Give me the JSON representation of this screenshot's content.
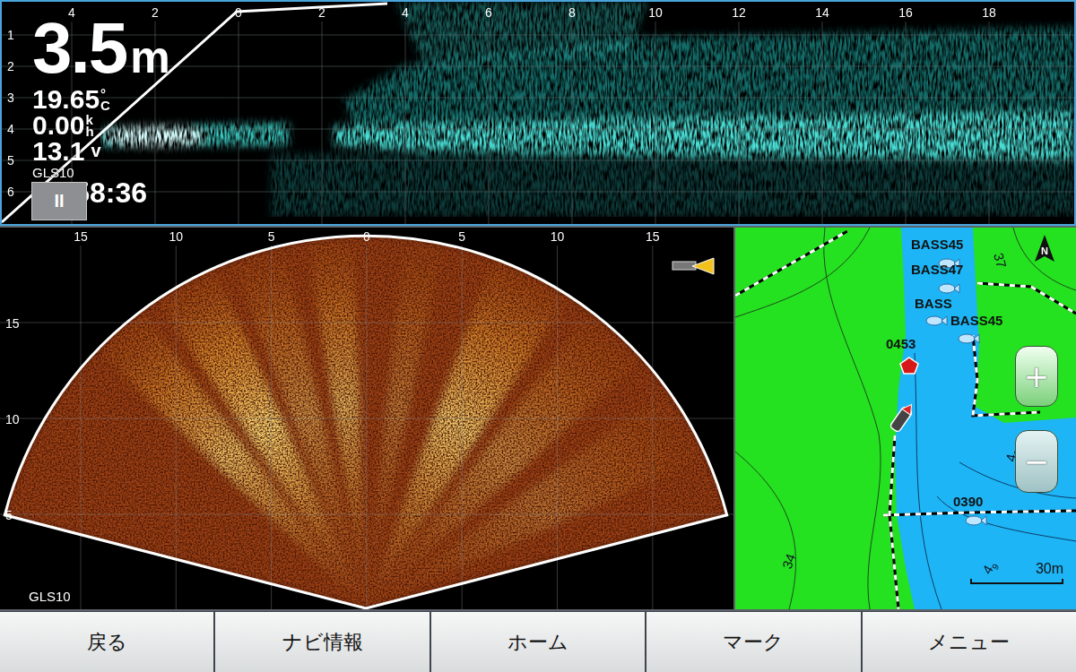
{
  "down_sonar": {
    "depth": "3.5",
    "depth_unit": "m",
    "temperature": "19.65",
    "temperature_unit": [
      "°",
      "C"
    ],
    "speed": "0.00",
    "speed_unit": [
      "k",
      "h"
    ],
    "voltage": "13.1",
    "voltage_unit": "v",
    "source": "GLS10",
    "time": "15:58:36",
    "pause_button": "II",
    "x_scale": [
      "4",
      "2",
      "0",
      "2",
      "4",
      "6",
      "8",
      "10",
      "12",
      "14",
      "16",
      "18"
    ],
    "depth_scale": [
      "1",
      "2",
      "3",
      "4",
      "5",
      "6"
    ]
  },
  "live_sonar": {
    "x_scale": [
      "15",
      "10",
      "5",
      "0",
      "5",
      "10",
      "15"
    ],
    "range_scale": [
      "15",
      "10",
      "5"
    ],
    "source": "GLS10"
  },
  "map": {
    "waypoints": [
      {
        "label": "BASS45",
        "kind": "fish"
      },
      {
        "label": "BASS47",
        "kind": "fish"
      },
      {
        "label": "BASS",
        "kind": "fish"
      },
      {
        "label": "BASS45",
        "kind": "fish"
      },
      {
        "label": "0453",
        "kind": "marker"
      },
      {
        "label": "0390",
        "kind": "fish"
      }
    ],
    "depth_labels": [
      {
        "text": "37",
        "sub": ""
      },
      {
        "text": "34",
        "sub": ""
      },
      {
        "text": "4",
        "sub": "9"
      },
      {
        "text": "4",
        "sub": "9"
      }
    ],
    "north": "N",
    "zoom_in": "+",
    "zoom_out": "−",
    "scale": "30m"
  },
  "bottom_bar": {
    "buttons": [
      {
        "label": "戻る"
      },
      {
        "label": "ナビ情報"
      },
      {
        "label": "ホーム"
      },
      {
        "label": "マーク"
      },
      {
        "label": "メニュー"
      }
    ]
  }
}
